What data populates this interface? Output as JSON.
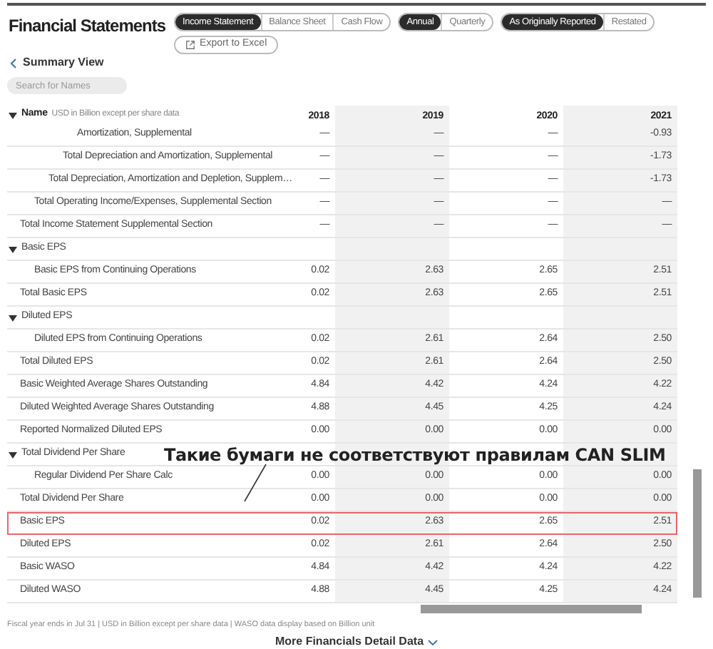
{
  "title": "Financial Statements",
  "toggle_groups": [
    {
      "options": [
        {
          "label": "Income Statement",
          "selected": true
        },
        {
          "label": "Balance Sheet",
          "selected": false
        },
        {
          "label": "Cash Flow",
          "selected": false
        }
      ]
    },
    {
      "options": [
        {
          "label": "Annual",
          "selected": true
        },
        {
          "label": "Quarterly",
          "selected": false
        }
      ]
    },
    {
      "options": [
        {
          "label": "As Originally Reported",
          "selected": true
        },
        {
          "label": "Restated",
          "selected": false
        }
      ]
    }
  ],
  "export_button": "Export to Excel",
  "back_link": "Summary View",
  "search": {
    "placeholder": "Search for Names"
  },
  "table": {
    "name_header": {
      "label": "Name",
      "note": "USD in Billion except per share data",
      "expanded": true
    },
    "columns": [
      "2018",
      "2019",
      "2020",
      "2021"
    ],
    "sections": [
      {
        "rows": [
          {
            "label": "Total Income Statement Supplemental Section",
            "values": [
              "—",
              "—",
              "—",
              "—"
            ],
            "highlighted": false,
            "children": [
              {
                "label": "Total Operating Income/Expenses, Supplemental Section",
                "values": [
                  "—",
                  "—",
                  "—",
                  "—"
                ],
                "highlighted": false,
                "children": [
                  {
                    "label": "Total Depreciation, Amortization and Depletion, Supplem…",
                    "values": [
                      "—",
                      "—",
                      "—",
                      "-1.73"
                    ],
                    "highlighted": false,
                    "children": [
                      {
                        "label": "Total Depreciation and Amortization, Supplemental",
                        "values": [
                          "—",
                          "—",
                          "—",
                          "-1.73"
                        ],
                        "highlighted": false,
                        "children": [
                          {
                            "label": "Amortization, Supplemental",
                            "values": [
                              "—",
                              "—",
                              "—",
                              "-0.93"
                            ],
                            "highlighted": false
                          }
                        ]
                      }
                    ]
                  }
                ]
              }
            ]
          }
        ]
      },
      {
        "header": {
          "label": "Basic EPS",
          "expanded": true
        },
        "rows": [
          {
            "label": "Total Basic EPS",
            "values": [
              "0.02",
              "2.63",
              "2.65",
              "2.51"
            ],
            "highlighted": false,
            "children": [
              {
                "label": "Basic EPS from Continuing Operations",
                "values": [
                  "0.02",
                  "2.63",
                  "2.65",
                  "2.51"
                ],
                "highlighted": false
              }
            ]
          }
        ]
      },
      {
        "header": {
          "label": "Diluted EPS",
          "expanded": true
        },
        "rows": [
          {
            "label": "Total Diluted EPS",
            "values": [
              "0.02",
              "2.61",
              "2.64",
              "2.50"
            ],
            "highlighted": false,
            "children": [
              {
                "label": "Diluted EPS from Continuing Operations",
                "values": [
                  "0.02",
                  "2.61",
                  "2.64",
                  "2.50"
                ],
                "highlighted": false
              }
            ]
          },
          {
            "label": "Basic Weighted Average Shares Outstanding",
            "values": [
              "4.84",
              "4.42",
              "4.24",
              "4.22"
            ],
            "highlighted": false
          },
          {
            "label": "Diluted Weighted Average Shares Outstanding",
            "values": [
              "4.88",
              "4.45",
              "4.25",
              "4.24"
            ],
            "highlighted": false
          },
          {
            "label": "Reported Normalized Diluted EPS",
            "values": [
              "0.00",
              "0.00",
              "0.00",
              "0.00"
            ],
            "highlighted": false
          }
        ]
      },
      {
        "header": {
          "label": "Total Dividend Per Share",
          "expanded": true,
          "annotation": "Такие бумаги не соответствуют правилам CAN SLIM"
        },
        "rows": [
          {
            "label": "Total Dividend Per Share",
            "values": [
              "0.00",
              "0.00",
              "0.00",
              "0.00"
            ],
            "highlighted": false,
            "children": [
              {
                "label": "Regular Dividend Per Share Calc",
                "values": [
                  "0.00",
                  "0.00",
                  "0.00",
                  "0.00"
                ],
                "highlighted": false
              }
            ]
          },
          {
            "label": "Basic EPS",
            "values": [
              "0.02",
              "2.63",
              "2.65",
              "2.51"
            ],
            "highlighted": true
          },
          {
            "label": "Diluted EPS",
            "values": [
              "0.02",
              "2.61",
              "2.64",
              "2.50"
            ],
            "highlighted": false
          },
          {
            "label": "Basic WASO",
            "values": [
              "4.84",
              "4.42",
              "4.24",
              "4.22"
            ],
            "highlighted": false
          },
          {
            "label": "Diluted WASO",
            "values": [
              "4.88",
              "4.45",
              "4.25",
              "4.24"
            ],
            "highlighted": false
          }
        ]
      }
    ]
  },
  "footnote": "Fiscal year ends in Jul 31 | USD in Billion except per share data | WASO data display based on Billion unit",
  "more_link": "More Financials Detail Data"
}
